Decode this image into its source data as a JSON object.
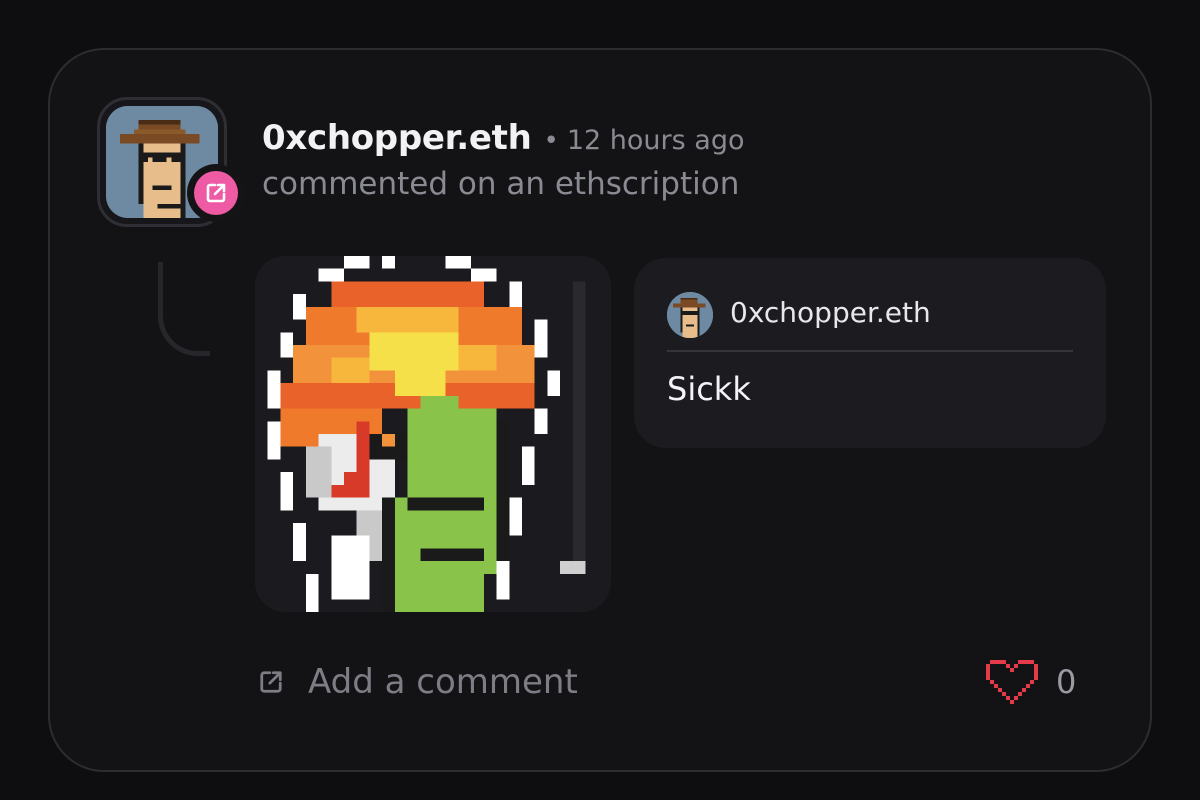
{
  "post": {
    "username": "0xchopper.eth",
    "separator": "•",
    "time": "12 hours ago",
    "action": "commented on an ethscription",
    "avatar_icon": "pixel-punk-cowboy-avatar",
    "badge_icon": "comment-edit-icon",
    "badge_color": "#ee5aa3"
  },
  "ethscription": {
    "image_icon": "pixel-art-orange-hair-green-face-image"
  },
  "comment": {
    "username": "0xchopper.eth",
    "text": "Sickk",
    "avatar_icon": "pixel-punk-cowboy-avatar"
  },
  "footer": {
    "add_comment_label": "Add a comment",
    "add_comment_icon": "comment-edit-icon",
    "like_icon": "pixel-heart-icon",
    "like_color": "#e53a4a",
    "like_count": "0"
  }
}
